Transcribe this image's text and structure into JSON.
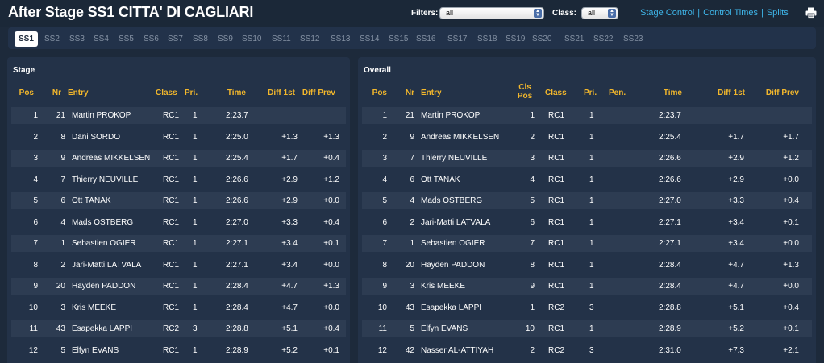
{
  "header": {
    "title": "After Stage SS1 CITTA' DI CAGLIARI",
    "filters_label": "Filters:",
    "filters_value": "all",
    "class_label": "Class:",
    "class_value": "all",
    "links": [
      "Stage Control",
      "Control Times",
      "Splits"
    ],
    "print_icon": "printer-icon"
  },
  "stages": [
    "SS1",
    "SS2",
    "SS3",
    "SS4",
    "SS5",
    "SS6",
    "SS7",
    "SS8",
    "SS9",
    "SS10",
    "SS11",
    "SS12",
    "SS13",
    "SS14",
    "SS15",
    "SS16",
    "SS17",
    "SS18",
    "SS19",
    "SS20",
    "SS21",
    "SS22",
    "SS23"
  ],
  "active_stage": "SS1",
  "stage_panel": {
    "title": "Stage",
    "headers": {
      "pos": "Pos",
      "nr": "Nr",
      "entry": "Entry",
      "class": "Class",
      "pri": "Pri.",
      "time": "Time",
      "diff1": "Diff 1st",
      "diffprev": "Diff Prev"
    },
    "rows": [
      {
        "pos": "1",
        "nr": "21",
        "entry": "Martin PROKOP",
        "class": "RC1",
        "pri": "1",
        "time": "2:23.7",
        "diff1": "",
        "diffprev": ""
      },
      {
        "pos": "2",
        "nr": "8",
        "entry": "Dani SORDO",
        "class": "RC1",
        "pri": "1",
        "time": "2:25.0",
        "diff1": "+1.3",
        "diffprev": "+1.3"
      },
      {
        "pos": "3",
        "nr": "9",
        "entry": "Andreas MIKKELSEN",
        "class": "RC1",
        "pri": "1",
        "time": "2:25.4",
        "diff1": "+1.7",
        "diffprev": "+0.4"
      },
      {
        "pos": "4",
        "nr": "7",
        "entry": "Thierry NEUVILLE",
        "class": "RC1",
        "pri": "1",
        "time": "2:26.6",
        "diff1": "+2.9",
        "diffprev": "+1.2"
      },
      {
        "pos": "5",
        "nr": "6",
        "entry": "Ott TANAK",
        "class": "RC1",
        "pri": "1",
        "time": "2:26.6",
        "diff1": "+2.9",
        "diffprev": "+0.0"
      },
      {
        "pos": "6",
        "nr": "4",
        "entry": "Mads OSTBERG",
        "class": "RC1",
        "pri": "1",
        "time": "2:27.0",
        "diff1": "+3.3",
        "diffprev": "+0.4"
      },
      {
        "pos": "7",
        "nr": "1",
        "entry": "Sebastien OGIER",
        "class": "RC1",
        "pri": "1",
        "time": "2:27.1",
        "diff1": "+3.4",
        "diffprev": "+0.1"
      },
      {
        "pos": "8",
        "nr": "2",
        "entry": "Jari-Matti LATVALA",
        "class": "RC1",
        "pri": "1",
        "time": "2:27.1",
        "diff1": "+3.4",
        "diffprev": "+0.0"
      },
      {
        "pos": "9",
        "nr": "20",
        "entry": "Hayden PADDON",
        "class": "RC1",
        "pri": "1",
        "time": "2:28.4",
        "diff1": "+4.7",
        "diffprev": "+1.3"
      },
      {
        "pos": "10",
        "nr": "3",
        "entry": "Kris MEEKE",
        "class": "RC1",
        "pri": "1",
        "time": "2:28.4",
        "diff1": "+4.7",
        "diffprev": "+0.0"
      },
      {
        "pos": "11",
        "nr": "43",
        "entry": "Esapekka LAPPI",
        "class": "RC2",
        "pri": "3",
        "time": "2:28.8",
        "diff1": "+5.1",
        "diffprev": "+0.4"
      },
      {
        "pos": "12",
        "nr": "5",
        "entry": "Elfyn EVANS",
        "class": "RC1",
        "pri": "1",
        "time": "2:28.9",
        "diff1": "+5.2",
        "diffprev": "+0.1"
      }
    ]
  },
  "overall_panel": {
    "title": "Overall",
    "headers": {
      "pos": "Pos",
      "nr": "Nr",
      "entry": "Entry",
      "clspos_1": "Cls",
      "clspos_2": "Pos",
      "class": "Class",
      "pri": "Pri.",
      "pen": "Pen.",
      "time": "Time",
      "diff1": "Diff 1st",
      "diffprev": "Diff Prev"
    },
    "rows": [
      {
        "pos": "1",
        "nr": "21",
        "entry": "Martin PROKOP",
        "clspos": "1",
        "class": "RC1",
        "pri": "1",
        "pen": "",
        "time": "2:23.7",
        "diff1": "",
        "diffprev": ""
      },
      {
        "pos": "2",
        "nr": "9",
        "entry": "Andreas MIKKELSEN",
        "clspos": "2",
        "class": "RC1",
        "pri": "1",
        "pen": "",
        "time": "2:25.4",
        "diff1": "+1.7",
        "diffprev": "+1.7"
      },
      {
        "pos": "3",
        "nr": "7",
        "entry": "Thierry NEUVILLE",
        "clspos": "3",
        "class": "RC1",
        "pri": "1",
        "pen": "",
        "time": "2:26.6",
        "diff1": "+2.9",
        "diffprev": "+1.2"
      },
      {
        "pos": "4",
        "nr": "6",
        "entry": "Ott TANAK",
        "clspos": "4",
        "class": "RC1",
        "pri": "1",
        "pen": "",
        "time": "2:26.6",
        "diff1": "+2.9",
        "diffprev": "+0.0"
      },
      {
        "pos": "5",
        "nr": "4",
        "entry": "Mads OSTBERG",
        "clspos": "5",
        "class": "RC1",
        "pri": "1",
        "pen": "",
        "time": "2:27.0",
        "diff1": "+3.3",
        "diffprev": "+0.4"
      },
      {
        "pos": "6",
        "nr": "2",
        "entry": "Jari-Matti LATVALA",
        "clspos": "6",
        "class": "RC1",
        "pri": "1",
        "pen": "",
        "time": "2:27.1",
        "diff1": "+3.4",
        "diffprev": "+0.1"
      },
      {
        "pos": "7",
        "nr": "1",
        "entry": "Sebastien OGIER",
        "clspos": "7",
        "class": "RC1",
        "pri": "1",
        "pen": "",
        "time": "2:27.1",
        "diff1": "+3.4",
        "diffprev": "+0.0"
      },
      {
        "pos": "8",
        "nr": "20",
        "entry": "Hayden PADDON",
        "clspos": "8",
        "class": "RC1",
        "pri": "1",
        "pen": "",
        "time": "2:28.4",
        "diff1": "+4.7",
        "diffprev": "+1.3"
      },
      {
        "pos": "9",
        "nr": "3",
        "entry": "Kris MEEKE",
        "clspos": "9",
        "class": "RC1",
        "pri": "1",
        "pen": "",
        "time": "2:28.4",
        "diff1": "+4.7",
        "diffprev": "+0.0"
      },
      {
        "pos": "10",
        "nr": "43",
        "entry": "Esapekka LAPPI",
        "clspos": "1",
        "class": "RC2",
        "pri": "3",
        "pen": "",
        "time": "2:28.8",
        "diff1": "+5.1",
        "diffprev": "+0.4"
      },
      {
        "pos": "11",
        "nr": "5",
        "entry": "Elfyn EVANS",
        "clspos": "10",
        "class": "RC1",
        "pri": "1",
        "pen": "",
        "time": "2:28.9",
        "diff1": "+5.2",
        "diffprev": "+0.1"
      },
      {
        "pos": "12",
        "nr": "42",
        "entry": "Nasser AL-ATTIYAH",
        "clspos": "2",
        "class": "RC2",
        "pri": "3",
        "pen": "",
        "time": "2:31.0",
        "diff1": "+7.3",
        "diffprev": "+2.1"
      }
    ]
  },
  "colors": {
    "background": "#1d2a3b",
    "panel": "#233248",
    "row_alt": "#2d3c52",
    "header_text": "#f2b72c",
    "link": "#3fb6ea"
  }
}
